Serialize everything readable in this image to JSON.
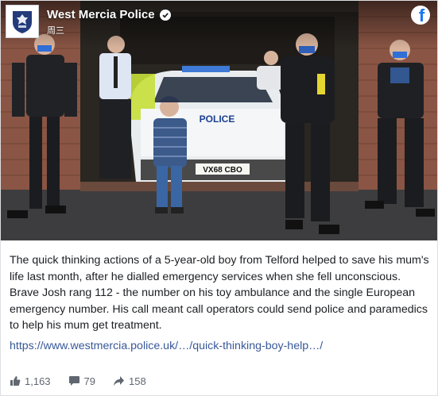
{
  "page": {
    "name": "West Mercia Police",
    "time": "周三",
    "verified_icon": "verified-check-icon",
    "platform_icon": "facebook-icon",
    "platform_letter": "f"
  },
  "photo": {
    "number_plate": "VX68 CBO",
    "car_hood_label": "POLICE"
  },
  "post": {
    "text": "The quick thinking actions of a 5-year-old boy from Telford helped to save his mum's life last month, after he dialled emergency services when she fell unconscious. Brave Josh rang 112 - the number on his toy ambulance and the single European emergency number. His call meant call operators could send police and paramedics to help his mum get treatment.",
    "link": "https://www.westmercia.police.uk/…/quick-thinking-boy-help…/"
  },
  "stats": {
    "likes": "1,163",
    "comments": "79",
    "shares": "158"
  },
  "colors": {
    "link": "#385898",
    "facebook_blue": "#1877f2",
    "text": "#1c1e21",
    "meta": "#606770"
  }
}
